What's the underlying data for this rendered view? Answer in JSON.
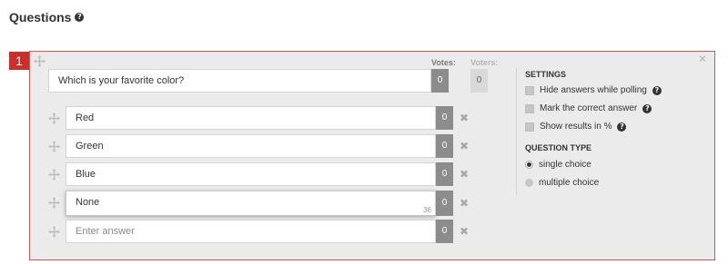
{
  "heading": {
    "title": "Questions",
    "help_glyph": "?"
  },
  "question": {
    "number": "1",
    "text": "Which is your favorite color?",
    "votes_label": "Votes:",
    "voters_label": "Voters:",
    "votes": "0",
    "voters": "0",
    "close_glyph": "✕"
  },
  "answers": [
    {
      "text": "Red",
      "votes": "0",
      "placeholder": ""
    },
    {
      "text": "Green",
      "votes": "0",
      "placeholder": ""
    },
    {
      "text": "Blue",
      "votes": "0",
      "placeholder": ""
    },
    {
      "text": "None",
      "votes": "0",
      "placeholder": "",
      "char_counter": "36"
    },
    {
      "text": "",
      "votes": "0",
      "placeholder": "Enter answer"
    }
  ],
  "remove_glyph": "✖",
  "settings": {
    "title": "SETTINGS",
    "options": [
      {
        "label": "Hide answers while polling",
        "help": "?"
      },
      {
        "label": "Mark the correct answer",
        "help": "?"
      },
      {
        "label": "Show results in %",
        "help": "?"
      }
    ],
    "question_type_title": "QUESTION TYPE",
    "types": [
      {
        "label": "single choice",
        "selected": true
      },
      {
        "label": "multiple choice",
        "selected": false
      }
    ]
  },
  "colors": {
    "accent": "#c9302c",
    "panel_border": "#d9534f",
    "panel_bg": "#ebebeb",
    "vote_box": "#8c8c8c"
  }
}
